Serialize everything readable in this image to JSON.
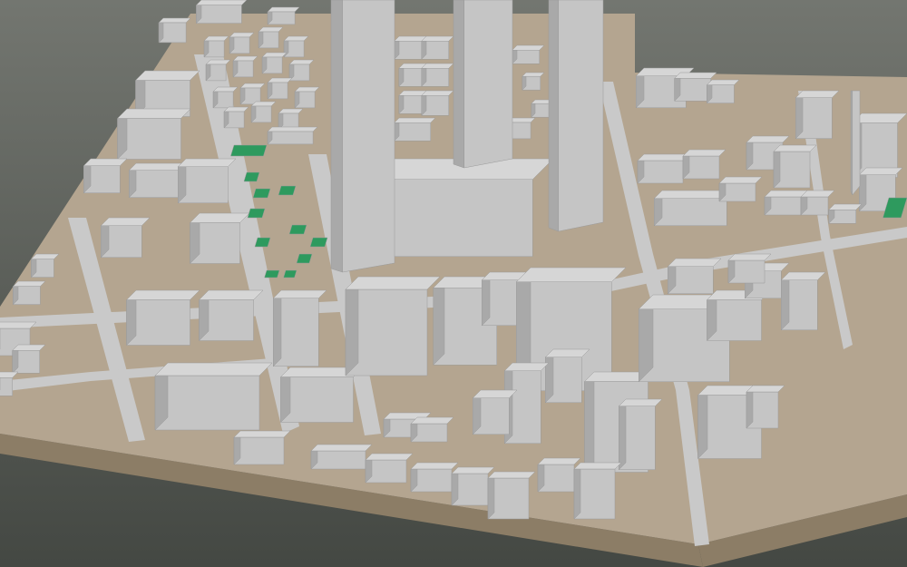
{
  "viewport": {
    "background_top": "#737670",
    "background_bottom": "#444843",
    "ground_color": "#b4a590",
    "ground_edge_color": "#8c7d66",
    "building_roof": "#d6d6d6",
    "building_light_face": "#c5c5c5",
    "building_dark_face": "#a9a9a9",
    "road_color": "#c9c9c9",
    "park_color": "#2e9a5e"
  },
  "layers": [
    {
      "name": "terrain"
    },
    {
      "name": "roads"
    },
    {
      "name": "buildings"
    },
    {
      "name": "parks"
    }
  ]
}
